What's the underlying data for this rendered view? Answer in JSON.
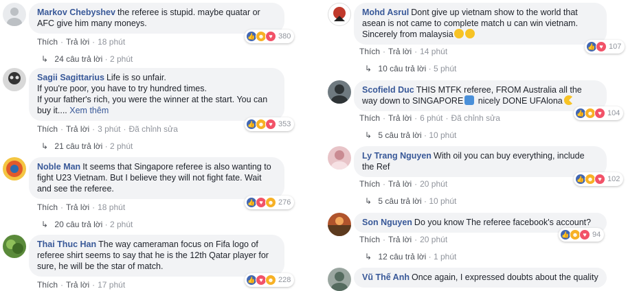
{
  "colors": {
    "bubble": "#f2f3f5",
    "author": "#385898",
    "meta": "#90949c",
    "like": "#4267b2",
    "haha": "#f7b125",
    "love": "#f25268"
  },
  "labels": {
    "like": "Thích",
    "reply": "Trả lời",
    "edited": "Đã chỉnh sửa",
    "see_more": "Xem thêm"
  },
  "left": [
    {
      "author": "Markov Chebyshev",
      "text": "the referee is stupid. maybe quatar or AFC give him many moneys.",
      "time": "18 phút",
      "count": "380",
      "replies": "24 câu trả lời",
      "replies_time": "2 phút"
    },
    {
      "author": "Sagii Sagittarius",
      "text": "Life is so unfair.",
      "text2": "If you're poor, you have to try hundred times.",
      "text3": "If your father's rich, you were the winner at the start. You can buy it....",
      "time": "3 phút",
      "count": "353",
      "replies": "21 câu trả lời",
      "replies_time": "2 phút"
    },
    {
      "author": "Noble Man",
      "text": "It seems that Singapore referee is also wanting to fight U23 Vietnam. But I believe they will not fight fate. Wait and see the referee.",
      "time": "18 phút",
      "count": "276",
      "replies": "20 câu trả lời",
      "replies_time": "2 phút"
    },
    {
      "author": "Thai Thuc Han",
      "text": "The way cameraman focus on Fifa logo of referee shirt seems to say that he is the 12th Qatar player for sure, he will be the star of match.",
      "time": "17 phút",
      "count": "228"
    }
  ],
  "right": [
    {
      "author": "Mohd Asrul",
      "text": "Dont give up vietnam show to the world that asean is not came to complete match u can win vietnam.",
      "text2": "Sincerely from malaysia",
      "time": "14 phút",
      "count": "107",
      "replies": "10 câu trả lời",
      "replies_time": "5 phút"
    },
    {
      "author": "Scofield Duc",
      "text": "THIS MTFK referee, FROM Australia all the way down to SINGAPORE",
      "text_b": "nicely DONE UFAlona",
      "time": "6 phút",
      "count": "104",
      "replies": "5 câu trả lời",
      "replies_time": "10 phút"
    },
    {
      "author": "Ly Trang Nguyen",
      "text": "With oil you can buy everything, include the Ref",
      "time": "20 phút",
      "count": "102",
      "replies": "5 câu trả lời",
      "replies_time": "10 phút"
    },
    {
      "author": "Son Nguyen",
      "text": "Do you know The referee facebook's account?",
      "time": "20 phút",
      "count": "94",
      "replies": "12 câu trả lời",
      "replies_time": "1 phút"
    },
    {
      "author": "Vũ Thế Anh",
      "text": "Once again, I expressed doubts about the quality"
    }
  ]
}
